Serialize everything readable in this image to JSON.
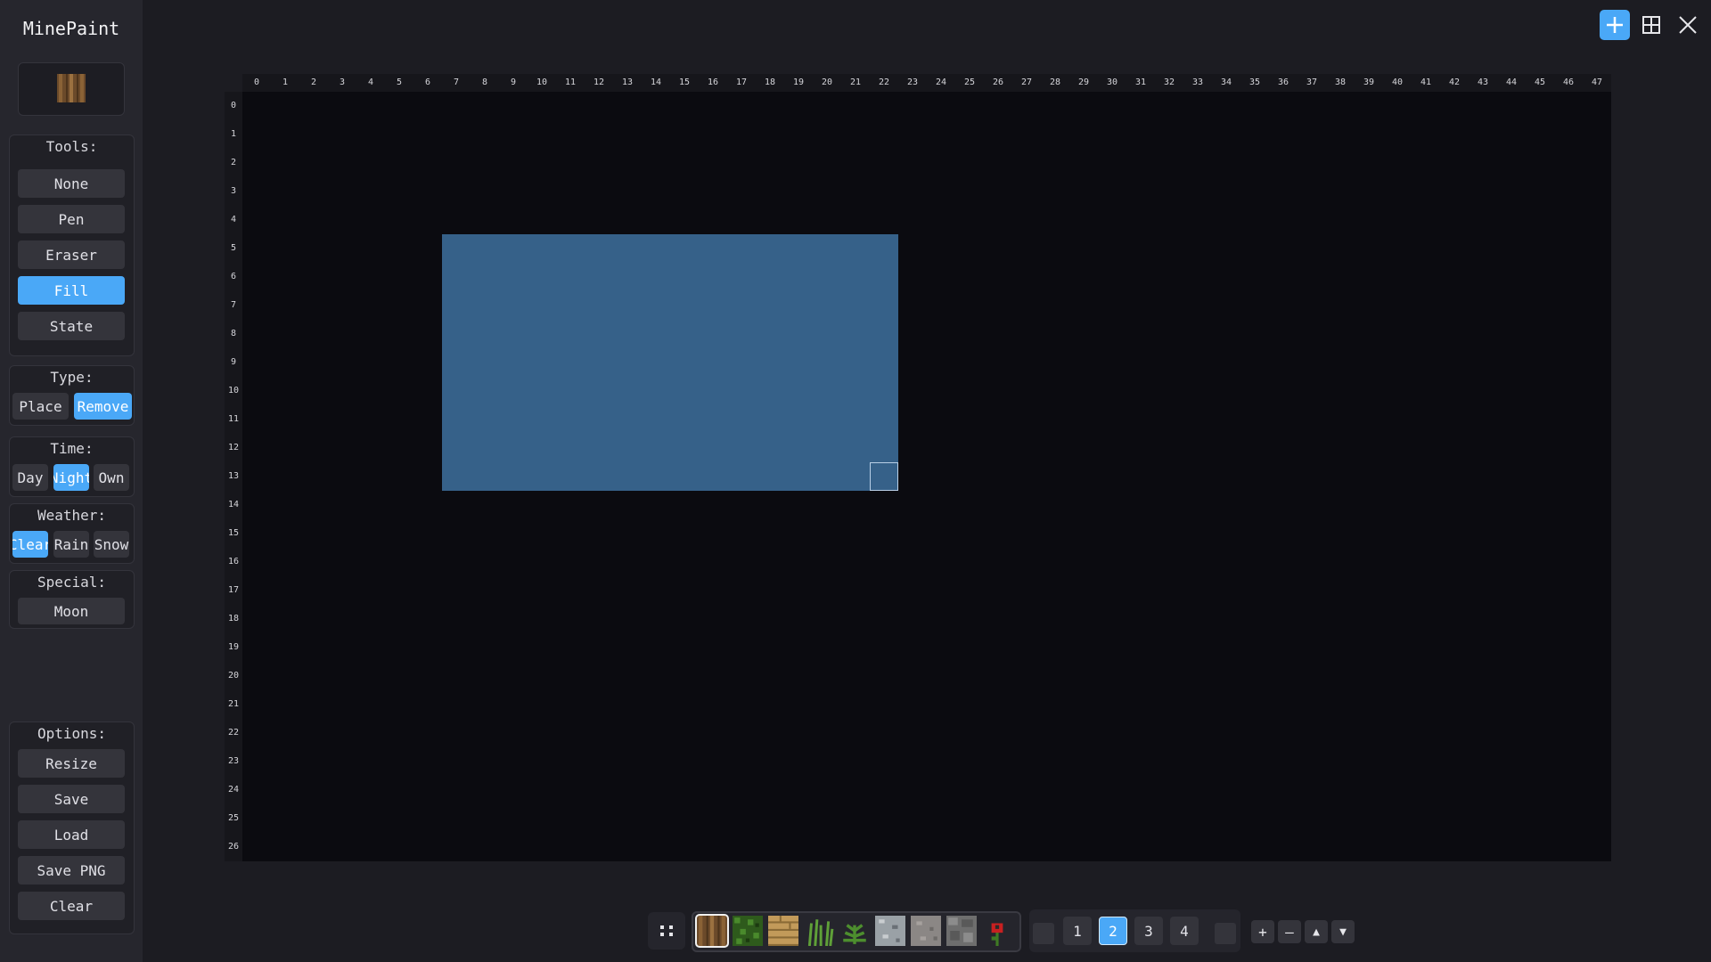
{
  "app": {
    "title": "MinePaint"
  },
  "tools": {
    "title": "Tools:",
    "items": [
      "None",
      "Pen",
      "Eraser",
      "Fill",
      "State"
    ],
    "selected": "Fill"
  },
  "type": {
    "title": "Type:",
    "items": [
      "Place",
      "Remove"
    ],
    "selected": "Remove"
  },
  "time": {
    "title": "Time:",
    "items": [
      "Day",
      "Night",
      "Own"
    ],
    "selected": "Night"
  },
  "weather": {
    "title": "Weather:",
    "items": [
      "Clear",
      "Rain",
      "Snow"
    ],
    "selected": "Clear"
  },
  "special": {
    "title": "Special:",
    "items": [
      "Moon"
    ]
  },
  "options": {
    "title": "Options:",
    "items": [
      "Resize",
      "Save",
      "Load",
      "Save PNG",
      "Clear"
    ]
  },
  "top_right": {
    "buttons": [
      {
        "icon": "plus-icon",
        "active": true
      },
      {
        "icon": "grid-icon",
        "active": false
      },
      {
        "icon": "close-icon",
        "active": false
      }
    ]
  },
  "grid": {
    "columns": [
      "0",
      "1",
      "2",
      "3",
      "4",
      "5",
      "6",
      "7",
      "8",
      "9",
      "10",
      "11",
      "12",
      "13",
      "14",
      "15",
      "16",
      "17",
      "18",
      "19",
      "20",
      "21",
      "22",
      "23",
      "24",
      "25",
      "26",
      "27",
      "28",
      "29",
      "30",
      "31",
      "32",
      "33",
      "34",
      "35",
      "36",
      "37",
      "38",
      "39",
      "40",
      "41",
      "42",
      "43",
      "44",
      "45",
      "46",
      "47"
    ],
    "rows": [
      "0",
      "1",
      "2",
      "3",
      "4",
      "5",
      "6",
      "7",
      "8",
      "9",
      "10",
      "11",
      "12",
      "13",
      "14",
      "15",
      "16",
      "17",
      "18",
      "19",
      "20",
      "21",
      "22",
      "23",
      "24",
      "25",
      "26"
    ],
    "selection": {
      "col_start": 7,
      "row_start": 5,
      "col_end": 22,
      "row_end": 13
    },
    "cursor_cell": {
      "col": 22,
      "row": 13
    },
    "colors": {
      "background": "#0b0b10",
      "selection": "#366189"
    }
  },
  "hotbar": {
    "blocks": [
      "oak-log",
      "oak-leaves",
      "oak-planks",
      "tall-grass",
      "fern",
      "diorite",
      "andesite",
      "cobblestone",
      "poppy"
    ],
    "selected_index": 0
  },
  "pages": {
    "items": [
      "1",
      "2",
      "3",
      "4"
    ],
    "selected": "2"
  },
  "controls": {
    "add": "+",
    "remove": "–",
    "up": "▲",
    "down": "▼"
  },
  "colors": {
    "accent": "#4aa8f7",
    "panel": "#202026",
    "button": "#34343b"
  }
}
